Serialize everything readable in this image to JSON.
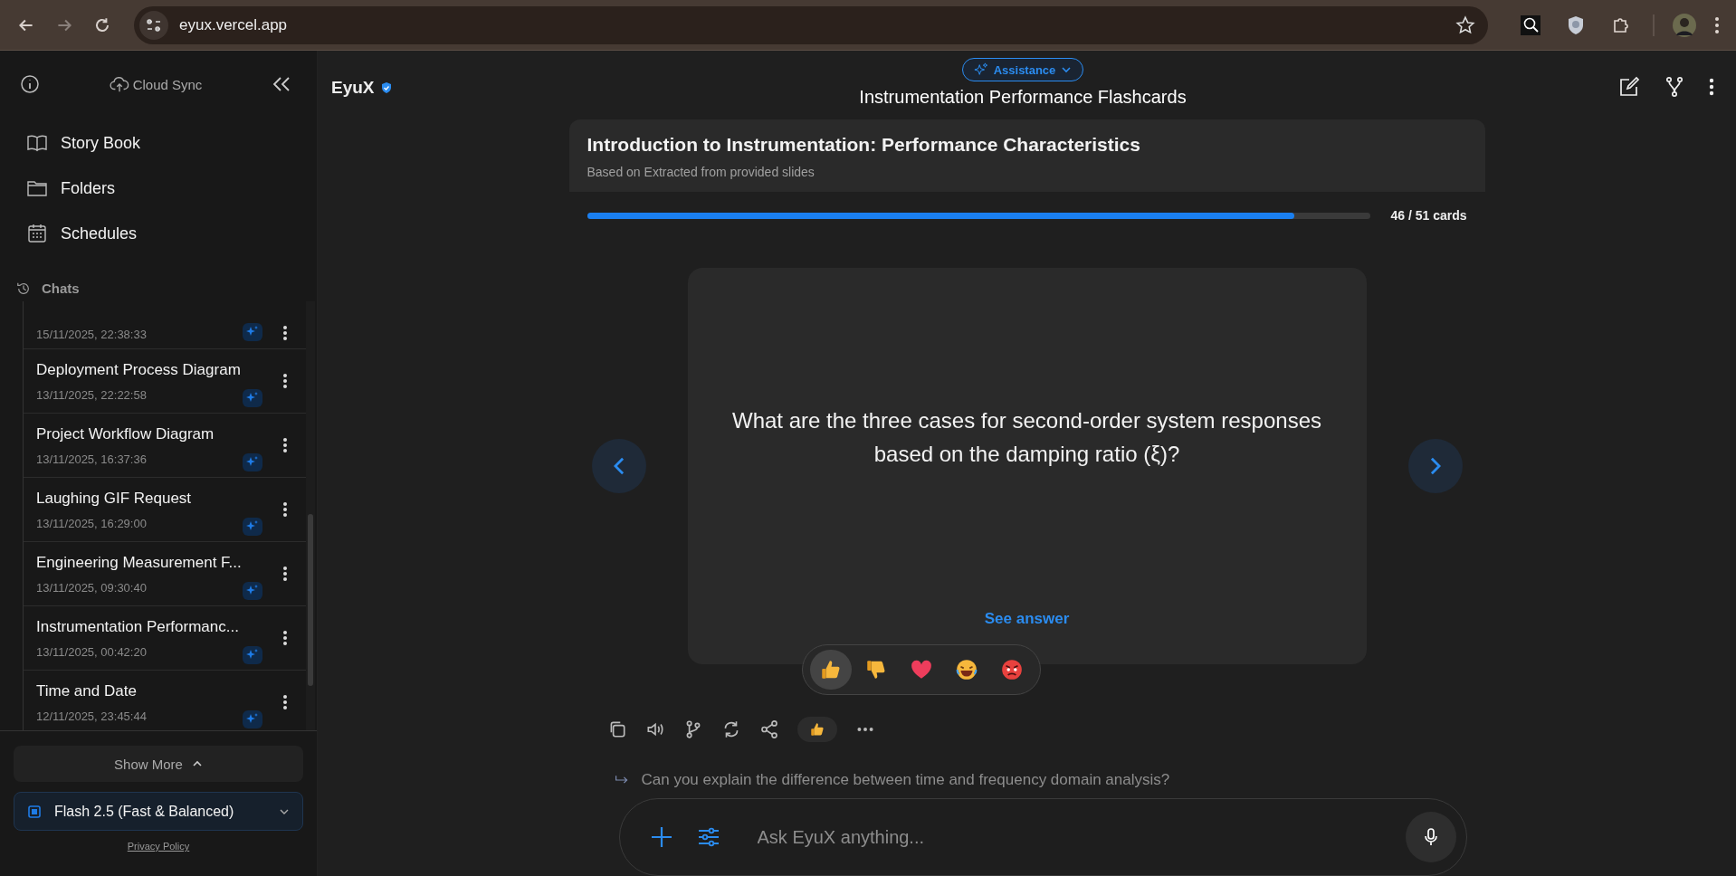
{
  "browser": {
    "url": "eyux.vercel.app"
  },
  "sidebar": {
    "cloud_sync": "Cloud Sync",
    "nav": [
      {
        "label": "Story Book",
        "kind": "book"
      },
      {
        "label": "Folders",
        "kind": "folder"
      },
      {
        "label": "Schedules",
        "kind": "calendar"
      }
    ],
    "chats_heading": "Chats",
    "chats": [
      {
        "time": "15/11/2025, 22:38:33"
      },
      {
        "title": "Deployment Process Diagram",
        "time": "13/11/2025, 22:22:58"
      },
      {
        "title": "Project Workflow Diagram",
        "time": "13/11/2025, 16:37:36"
      },
      {
        "title": "Laughing GIF Request",
        "time": "13/11/2025, 16:29:00"
      },
      {
        "title": "Engineering Measurement F...",
        "time": "13/11/2025, 09:30:40"
      },
      {
        "title": "Instrumentation Performanc...",
        "time": "13/11/2025, 00:42:20"
      },
      {
        "title": "Time and Date",
        "time": "12/11/2025, 23:45:44"
      }
    ],
    "show_more": "Show More",
    "model": "Flash 2.5 (Fast & Balanced)",
    "privacy": "Privacy Policy"
  },
  "header": {
    "brand": "EyuX",
    "verified": true,
    "mode": "Assistance",
    "title": "Instrumentation Performance Flashcards"
  },
  "deck": {
    "title": "Introduction to Instrumentation: Performance Characteristics",
    "source": "Based on Extracted from provided slides",
    "level": 0.902,
    "count": "46 / 51 cards"
  },
  "card": {
    "question": "What are the three cases for second-order system responses based on the damping ratio (ξ)?",
    "see_answer": "See answer"
  },
  "reactions": [
    {
      "kind": "thumbs_up",
      "selected": true
    },
    {
      "kind": "thumbs_down",
      "selected": false
    },
    {
      "kind": "heart",
      "selected": false
    },
    {
      "kind": "laugh",
      "selected": false
    },
    {
      "kind": "angry",
      "selected": false
    }
  ],
  "actions": [
    {
      "kind": "copy"
    },
    {
      "kind": "speaker"
    },
    {
      "kind": "branch"
    },
    {
      "kind": "refresh"
    },
    {
      "kind": "share"
    },
    {
      "kind": "reaction"
    },
    {
      "kind": "more"
    }
  ],
  "suggestion": "Can you explain the difference between time and frequency domain analysis?",
  "composer": {
    "placeholder": "Ask EyuX anything..."
  }
}
